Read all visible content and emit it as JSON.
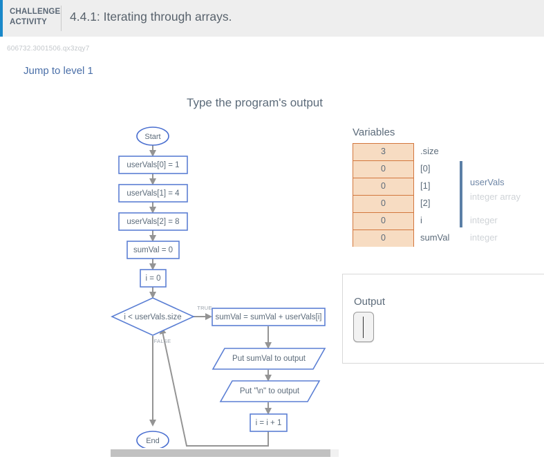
{
  "header": {
    "category_label": "CHALLENGE ACTIVITY",
    "activity_title": "4.4.1: Iterating through arrays.",
    "accent_color": "#1a88c9",
    "background_color": "#eeeeee"
  },
  "subheader": {
    "activity_id": "606732.3001506.qx3zqy7",
    "jump_link_label": "Jump to level 1"
  },
  "main": {
    "prompt_title": "Type the program's output"
  },
  "flowchart": {
    "start_label": "Start",
    "end_label": "End",
    "nodes": [
      {
        "id": "start",
        "shape": "terminator",
        "label": "Start"
      },
      {
        "id": "a0",
        "shape": "process",
        "label": "userVals[0] = 1"
      },
      {
        "id": "a1",
        "shape": "process",
        "label": "userVals[1] = 4"
      },
      {
        "id": "a2",
        "shape": "process",
        "label": "userVals[2] = 8"
      },
      {
        "id": "sum0",
        "shape": "process",
        "label": "sumVal = 0"
      },
      {
        "id": "i0",
        "shape": "process",
        "label": "i = 0"
      },
      {
        "id": "cond",
        "shape": "decision",
        "label": "i < userVals.size"
      },
      {
        "id": "accum",
        "shape": "process",
        "label": "sumVal = sumVal + userVals[i]"
      },
      {
        "id": "putsum",
        "shape": "parallelogram",
        "label": "Put sumVal to output"
      },
      {
        "id": "putnl",
        "shape": "parallelogram",
        "label": "Put \"\\n\" to output"
      },
      {
        "id": "inc",
        "shape": "process",
        "label": "i = i + 1"
      },
      {
        "id": "end",
        "shape": "terminator",
        "label": "End"
      }
    ],
    "branch_labels": {
      "true": "TRUE",
      "false": "FALSE"
    },
    "colors": {
      "shape_border": "#5b7fd4",
      "connector": "#949494",
      "text": "#5c6b7a",
      "branch_label": "#9aa2ab"
    }
  },
  "variables": {
    "heading": "Variables",
    "rows": [
      {
        "value": "3",
        "name": ".size",
        "type": ""
      },
      {
        "value": "0",
        "name": "[0]",
        "type": ""
      },
      {
        "value": "0",
        "name": "[1]",
        "type": ""
      },
      {
        "value": "0",
        "name": "[2]",
        "type": ""
      },
      {
        "value": "0",
        "name": "i",
        "type": "integer"
      },
      {
        "value": "0",
        "name": "sumVal",
        "type": "integer"
      }
    ],
    "array_group": {
      "name": "userVals",
      "type": "integer array",
      "bracket_color": "#5b7fa6"
    },
    "cell_fill": "#f7dcc2",
    "cell_border": "#d2763c"
  },
  "output": {
    "label": "Output",
    "value": "",
    "caret_visible": true
  },
  "scrollbar": {
    "orientation": "horizontal",
    "thumb_color": "#c1c1c1"
  }
}
